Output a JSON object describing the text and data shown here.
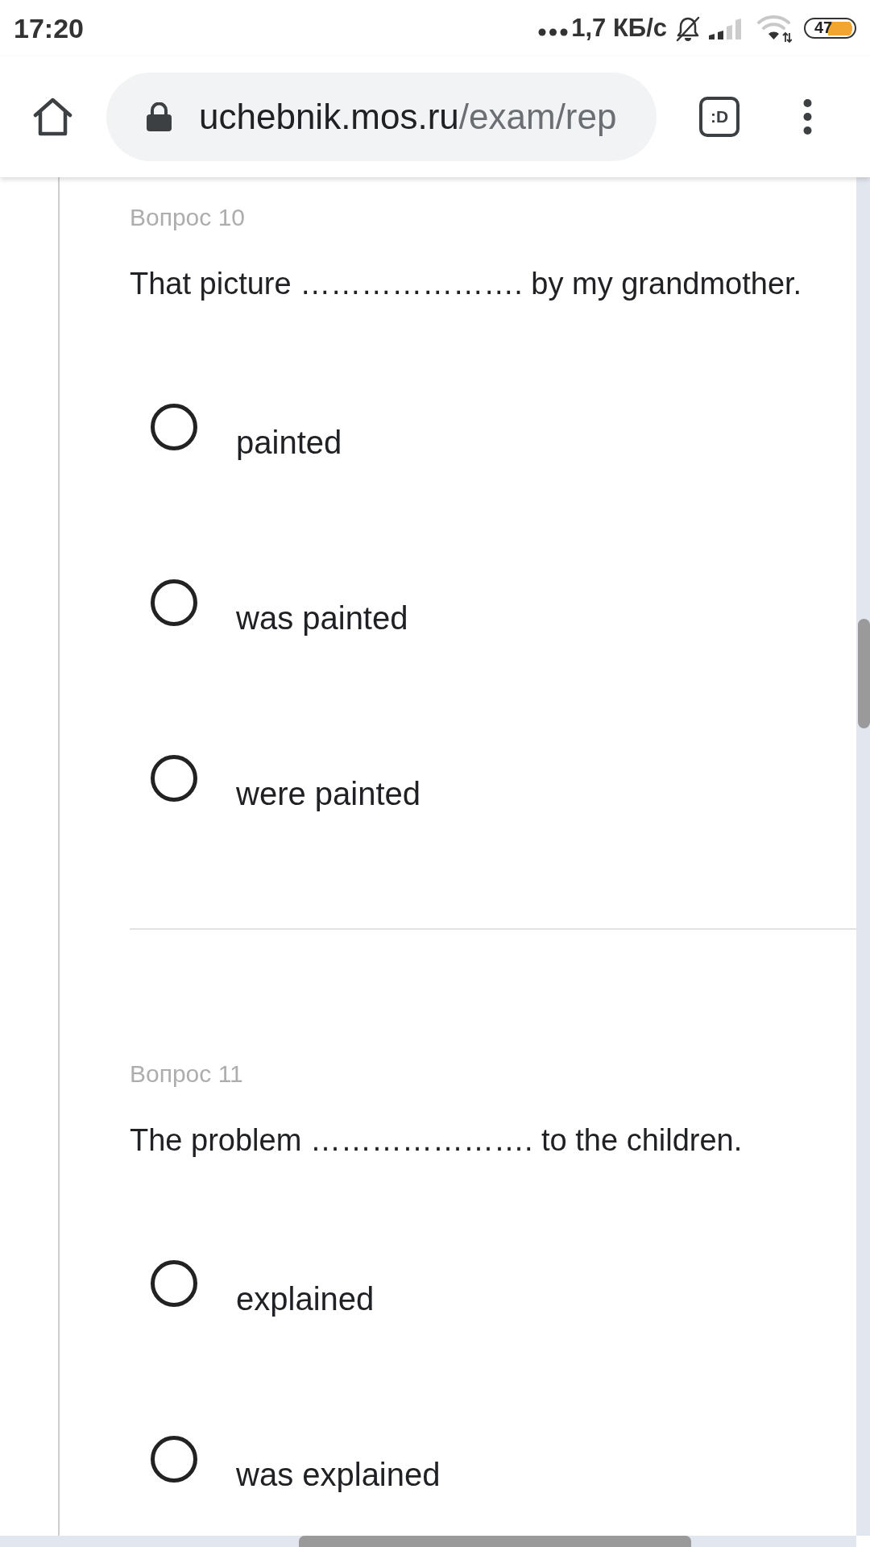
{
  "status_bar": {
    "time": "17:20",
    "network_speed": "1,7 КБ/с",
    "battery_percent": "47"
  },
  "browser_toolbar": {
    "url_host": "uchebnik.mos.ru",
    "url_path": "/exam/rep",
    "tab_switcher_label": ":D"
  },
  "questions": [
    {
      "label": "Вопрос 10",
      "text": "That picture …………………. by my grandmother.",
      "options": [
        {
          "label": "painted",
          "selected": false
        },
        {
          "label": "was painted",
          "selected": false
        },
        {
          "label": "were painted",
          "selected": false
        }
      ]
    },
    {
      "label": "Вопрос 11",
      "text": "The problem …………………. to the children.",
      "options": [
        {
          "label": "explained",
          "selected": false
        },
        {
          "label": "was explained",
          "selected": false
        }
      ]
    }
  ]
}
